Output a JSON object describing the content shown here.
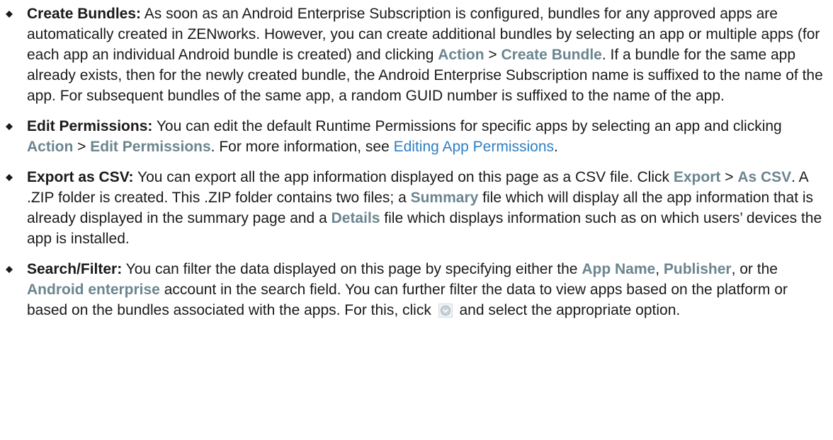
{
  "items": [
    {
      "term": "Create Bundles:",
      "t1": " As soon as an Android Enterprise Subscription is configured, bundles for any approved apps are automatically created in ZENworks. However, you can create additional bundles by selecting an app or multiple apps (for each app an individual Android bundle is created) and clicking ",
      "ui1": "Action",
      "sep1": " > ",
      "ui2": "Create Bundle",
      "t2": ". If a bundle for the same app already exists, then for the newly created bundle, the Android Enterprise Subscription name is suffixed to the name of the app. For subsequent bundles of the same app, a random GUID number is suffixed to the name of the app."
    },
    {
      "term": "Edit Permissions:",
      "t1": " You can edit the default Runtime Permissions for specific apps by selecting an app and clicking ",
      "ui1": "Action",
      "sep1": " > ",
      "ui2": "Edit Permissions",
      "t2": ". For more information, see ",
      "link": "Editing App Permissions",
      "t3": "."
    },
    {
      "term": "Export as CSV:",
      "t1": " You can export all the app information displayed on this page as a CSV file. Click ",
      "ui1": "Export",
      "sep1": " > ",
      "ui2": "As CSV",
      "t2": ". A .ZIP folder is created. This .ZIP folder contains two files; a ",
      "ui3": "Summary",
      "t3": " file which will display all the app information that is already displayed in the summary page and a ",
      "ui4": "Details",
      "t4": " file which displays information such as on which users’ devices the app is installed."
    },
    {
      "term": "Search/Filter:",
      "t1": " You can filter the data displayed on this page by specifying either the ",
      "ui1": "App Name",
      "t2": ", ",
      "ui2": "Publisher",
      "t3": ", or the ",
      "ui3": "Android enterprise",
      "t4": " account in the search field. You can further filter the data to view apps based on the platform or based on the bundles associated with the apps. For this, click ",
      "icon": "filter-dropdown-icon",
      "t5": " and select the appropriate option."
    }
  ],
  "colors": {
    "text": "#1a1a1a",
    "ui_label": "#6b8590",
    "link": "#2f7fc1",
    "bullet": "#1a1a1a"
  }
}
